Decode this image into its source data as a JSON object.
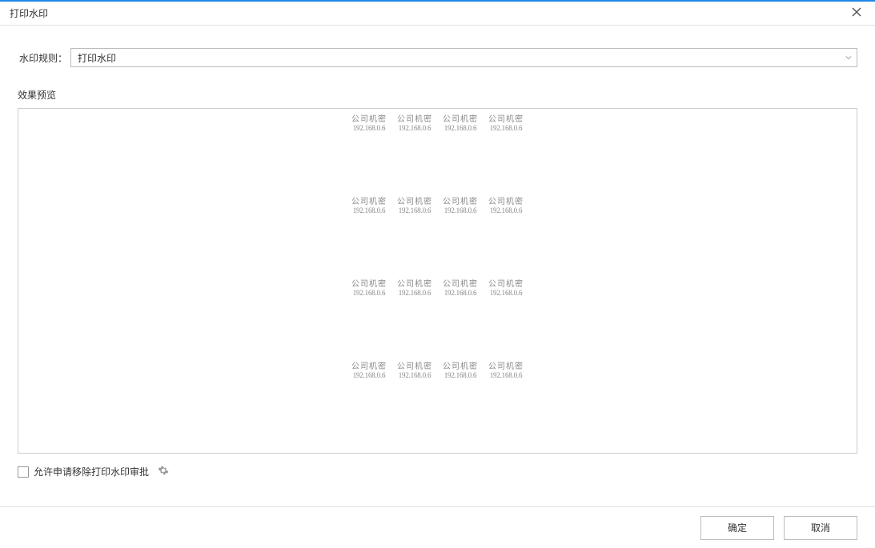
{
  "window": {
    "title": "打印水印"
  },
  "rule": {
    "label": "水印规则",
    "colon": "：",
    "value": "打印水印"
  },
  "preview": {
    "label": "效果预览",
    "watermark_text1": "公司机密",
    "watermark_text2": "192.168.0.6",
    "rows": 4,
    "cols": 4
  },
  "approval": {
    "checkbox_label": "允许申请移除打印水印审批",
    "checked": false
  },
  "buttons": {
    "ok": "确定",
    "cancel": "取消"
  }
}
